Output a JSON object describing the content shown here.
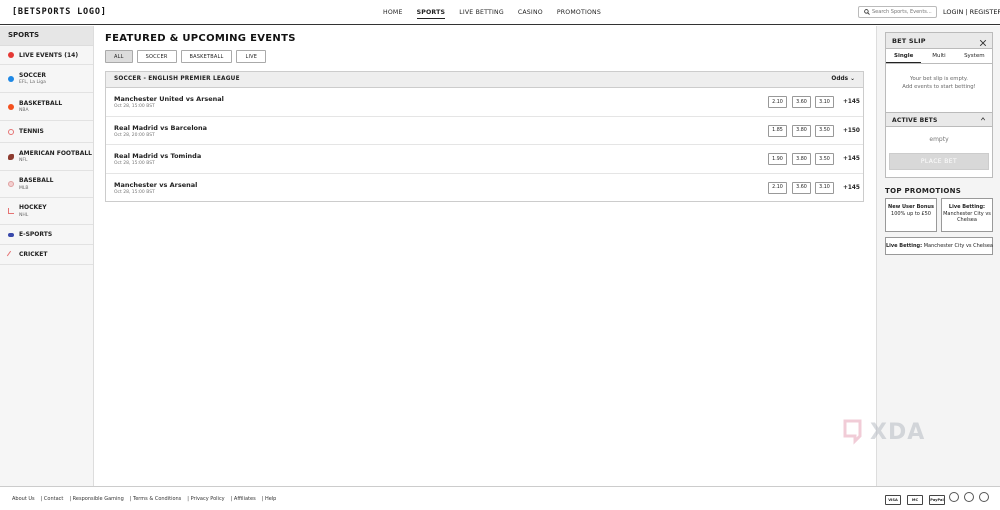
{
  "header": {
    "logo": "[BETSPORTS LOGO]",
    "nav": [
      {
        "label": "HOME",
        "active": false
      },
      {
        "label": "SPORTS",
        "active": true
      },
      {
        "label": "LIVE BETTING",
        "active": false
      },
      {
        "label": "CASINO",
        "active": false
      },
      {
        "label": "PROMOTIONS",
        "active": false
      }
    ],
    "search_placeholder": "Search Sports, Events...",
    "auth": "LOGIN | REGISTER"
  },
  "sidebar": {
    "title": "SPORTS",
    "items": [
      {
        "label": "LIVE EVENTS (14)",
        "sub": "",
        "icon": "live-dot-icon",
        "color": "#e53935"
      },
      {
        "label": "SOCCER",
        "sub": "EFL, La Liga",
        "icon": "soccer-ball-icon",
        "color": "#1e88e5"
      },
      {
        "label": "BASKETBALL",
        "sub": "NBA",
        "icon": "basketball-icon",
        "color": "#f4511e"
      },
      {
        "label": "TENNIS",
        "sub": "",
        "icon": "tennis-racket-icon",
        "color": "#e57373"
      },
      {
        "label": "AMERICAN FOOTBALL",
        "sub": "NFL",
        "icon": "football-icon",
        "color": "#8d3b2f"
      },
      {
        "label": "BASEBALL",
        "sub": "MLB",
        "icon": "baseball-icon",
        "color": "#e0a0a0"
      },
      {
        "label": "HOCKEY",
        "sub": "NHL",
        "icon": "hockey-stick-icon",
        "color": "#e57373"
      },
      {
        "label": "E-SPORTS",
        "sub": "",
        "icon": "gamepad-icon",
        "color": "#3949ab"
      },
      {
        "label": "CRICKET",
        "sub": "",
        "icon": "cricket-bat-icon",
        "color": "#e57373"
      }
    ]
  },
  "main": {
    "title": "FEATURED & UPCOMING EVENTS",
    "filters": [
      {
        "label": "ALL",
        "active": true
      },
      {
        "label": "SOCCER",
        "active": false
      },
      {
        "label": "BASKETBALL",
        "active": false
      },
      {
        "label": "LIVE",
        "active": false
      }
    ],
    "league": "SOCCER - ENGLISH PREMIER LEAGUE",
    "odds_header": "Odds",
    "matches": [
      {
        "title": "Manchester United vs Arsenal",
        "time": "Oct 28, 15:00 BST",
        "odds": [
          "2.10",
          "3.60",
          "3.10"
        ],
        "more": "+145"
      },
      {
        "title": "Real Madrid vs Barcelona",
        "time": "Oct 28, 20:00 BST",
        "odds": [
          "1.85",
          "3.80",
          "3.50"
        ],
        "more": "+150"
      },
      {
        "title": "Real Madrid vs Tominda",
        "time": "Oct 28, 15:00 BST",
        "odds": [
          "1.90",
          "3.80",
          "3.50"
        ],
        "more": "+145"
      },
      {
        "title": "Manchester vs Arsenal",
        "time": "Oct 28, 15:00 BST",
        "odds": [
          "2.10",
          "3.60",
          "3.10"
        ],
        "more": "+145"
      }
    ]
  },
  "betslip": {
    "title": "BET SLIP",
    "tabs": [
      "Single",
      "Multi",
      "System"
    ],
    "empty_line1": "Your bet slip is empty.",
    "empty_line2": "Add events to start betting!",
    "active_bets_title": "ACTIVE BETS",
    "active_bets_empty": "empty",
    "place_bet": "PLACE BET"
  },
  "promotions": {
    "title": "TOP PROMOTIONS",
    "card1_head": "New User Bonus",
    "card1_body": "100% up to £50",
    "card2_head": "Live Betting:",
    "card2_body": "Manchester City vs Chelsea",
    "wide_head": "Live Betting:",
    "wide_body": " Manchester City vs Chelsea"
  },
  "footer": {
    "links": [
      "About Us",
      "| Contact",
      "| Responsible Gaming",
      "| Terms & Conditions",
      "| Privacy Policy",
      "| Affiliates",
      "| Help"
    ],
    "payments": [
      "VISA",
      "MC",
      "PayPal"
    ]
  },
  "watermark": "XDA"
}
